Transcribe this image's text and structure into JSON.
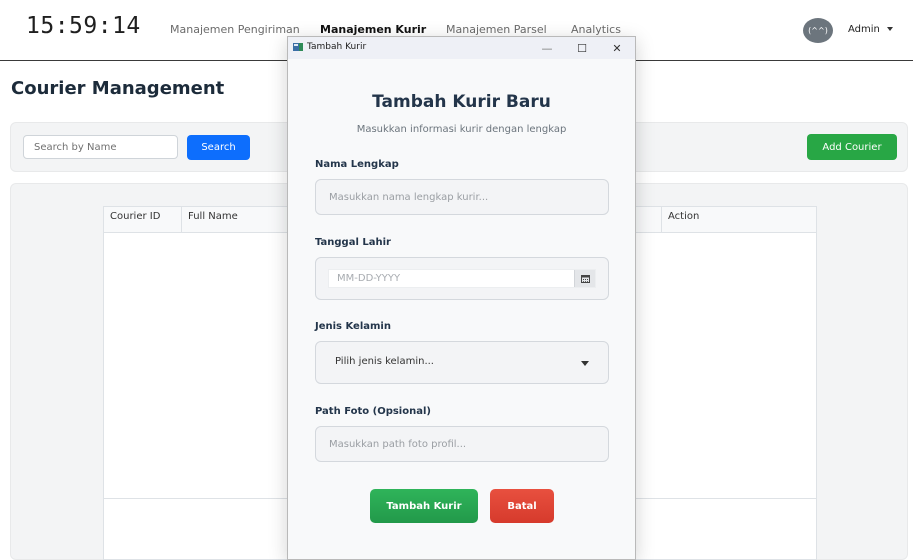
{
  "header": {
    "clock": "15:59:14",
    "nav": [
      {
        "label": "Manajemen Pengiriman",
        "active": false
      },
      {
        "label": "Manajemen Kurir",
        "active": true
      },
      {
        "label": "Manajemen Parsel",
        "active": false
      },
      {
        "label": "Analytics",
        "active": false
      }
    ],
    "avatar_text": "(^^)",
    "user_label": "Admin"
  },
  "page": {
    "title": "Courier Management",
    "search": {
      "placeholder": "Search by Name",
      "value": ""
    },
    "search_button": "Search",
    "add_button": "Add Courier",
    "table": {
      "columns": [
        "Courier ID",
        "Full Name",
        "",
        "",
        "",
        "",
        "Action"
      ],
      "rows": []
    }
  },
  "dialog": {
    "window_title": "Tambah Kurir",
    "title": "Tambah Kurir Baru",
    "subtitle": "Masukkan informasi kurir dengan lengkap",
    "fields": {
      "name": {
        "label": "Nama Lengkap",
        "placeholder": "Masukkan nama lengkap kurir...",
        "value": ""
      },
      "dob": {
        "label": "Tanggal Lahir",
        "placeholder": "MM-DD-YYYY",
        "value": ""
      },
      "gender": {
        "label": "Jenis Kelamin",
        "selected": "Pilih jenis kelamin..."
      },
      "photo": {
        "label": "Path Foto (Opsional)",
        "placeholder": "Masukkan path foto profil...",
        "value": ""
      }
    },
    "submit_button": "Tambah Kurir",
    "cancel_button": "Batal",
    "window_controls": {
      "minimize": "—",
      "maximize": "☐",
      "close": "✕"
    }
  },
  "colors": {
    "primary_blue": "#0d6efd",
    "success_green": "#28a745",
    "danger_red": "#dc3545",
    "heading_navy": "#23354a"
  }
}
